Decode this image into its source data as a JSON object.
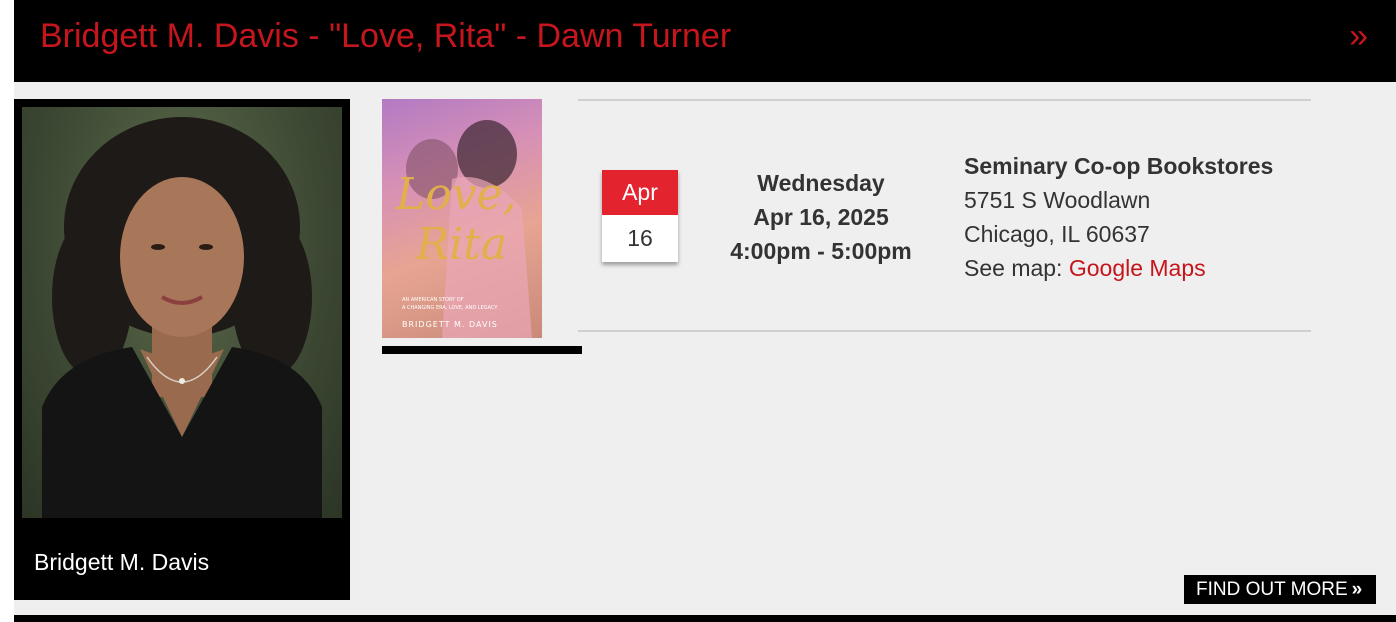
{
  "event": {
    "title": "Bridgett M. Davis - \"Love, Rita\" - Dawn Turner",
    "arrow": "»"
  },
  "author": {
    "caption": "Bridgett M. Davis"
  },
  "book": {
    "cover_title_line1": "Love,",
    "cover_title_line2": "Rita",
    "cover_subtitle": "AN AMERICAN STORY OF",
    "cover_subtitle2": "A CHANGING ERA, LOVE, AND LEGACY",
    "cover_author": "BRIDGETT M. DAVIS"
  },
  "calendar": {
    "month": "Apr",
    "day": "16"
  },
  "datetime": {
    "weekday": "Wednesday",
    "date": "Apr 16, 2025",
    "time": "4:00pm - 5:00pm"
  },
  "venue": {
    "name": "Seminary Co-op Bookstores",
    "street": "5751 S Woodlawn",
    "city": "Chicago, IL 60637",
    "map_label": "See map: ",
    "map_link": "Google Maps"
  },
  "cta": {
    "label": "FIND OUT MORE",
    "chevron": "»"
  },
  "colors": {
    "accent_red": "#c4161c",
    "calendar_red": "#e3242f",
    "background": "#efefef",
    "header": "#000000"
  }
}
